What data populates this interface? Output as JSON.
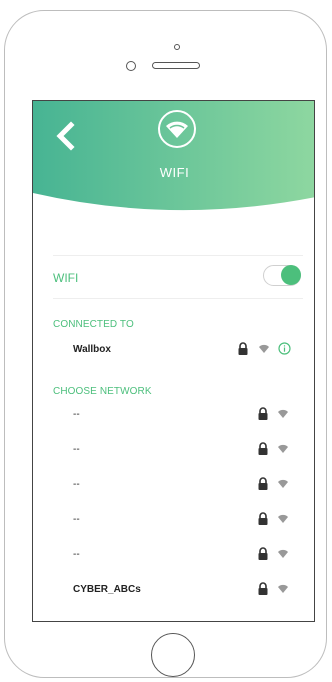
{
  "header": {
    "title": "WIFI",
    "back_icon": "chevron-left-icon",
    "logo_icon": "wifi-icon"
  },
  "wifi_toggle": {
    "label": "WIFI",
    "enabled": true
  },
  "connected": {
    "section_title": "CONNECTED TO",
    "network": {
      "name": "Wallbox",
      "secured": true
    }
  },
  "choose": {
    "section_title": "CHOOSE NETWORK",
    "networks": [
      {
        "name": "--",
        "secured": true
      },
      {
        "name": "--",
        "secured": true
      },
      {
        "name": "--",
        "secured": true
      },
      {
        "name": "--",
        "secured": true
      },
      {
        "name": "--",
        "secured": true
      },
      {
        "name": "CYBER_ABCs",
        "secured": true
      }
    ]
  },
  "colors": {
    "accent": "#4cbf7c",
    "header_gradient_start": "#47b493",
    "header_gradient_end": "#8ed7a0",
    "icon_gray": "#333333"
  }
}
